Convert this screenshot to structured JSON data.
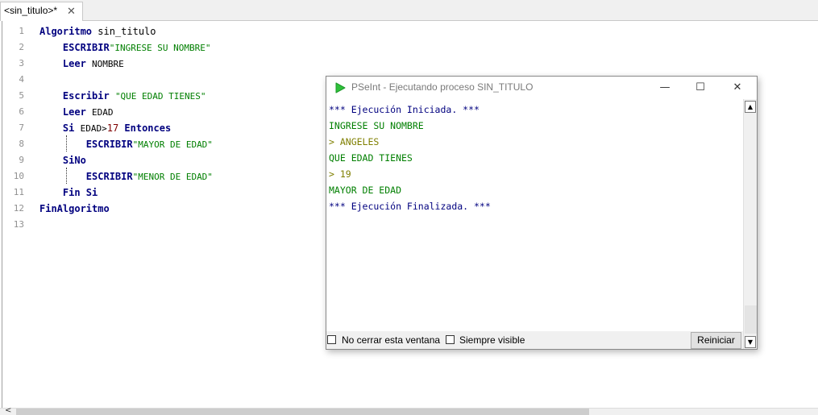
{
  "editor_tab": {
    "title": "<sin_titulo>*",
    "close_symbol": "✕"
  },
  "code_lines": [
    {
      "num": "1",
      "t": [
        {
          "c": "kw",
          "v": "Algoritmo"
        },
        {
          "c": "id",
          "v": " sin_titulo"
        }
      ]
    },
    {
      "num": "2",
      "t": [
        {
          "c": "sp",
          "v": "    "
        },
        {
          "c": "kw",
          "v": "ESCRIBIR"
        },
        {
          "c": "str",
          "v": "\"INGRESE SU NOMBRE\""
        }
      ]
    },
    {
      "num": "3",
      "t": [
        {
          "c": "sp",
          "v": "    "
        },
        {
          "c": "kw",
          "v": "Leer"
        },
        {
          "c": "id",
          "v": " "
        },
        {
          "c": "up",
          "v": "NOMBRE"
        }
      ]
    },
    {
      "num": "4",
      "t": []
    },
    {
      "num": "5",
      "t": [
        {
          "c": "sp",
          "v": "    "
        },
        {
          "c": "kw",
          "v": "Escribir"
        },
        {
          "c": "id",
          "v": " "
        },
        {
          "c": "str",
          "v": "\"QUE EDAD TIENES\""
        }
      ]
    },
    {
      "num": "6",
      "t": [
        {
          "c": "sp",
          "v": "    "
        },
        {
          "c": "kw",
          "v": "Leer"
        },
        {
          "c": "id",
          "v": " "
        },
        {
          "c": "up",
          "v": "EDAD"
        }
      ]
    },
    {
      "num": "7",
      "t": [
        {
          "c": "sp",
          "v": "    "
        },
        {
          "c": "kw",
          "v": "Si"
        },
        {
          "c": "id",
          "v": " "
        },
        {
          "c": "up",
          "v": "EDAD>"
        },
        {
          "c": "num",
          "v": "17"
        },
        {
          "c": "id",
          "v": " "
        },
        {
          "c": "kw",
          "v": "Entonces"
        }
      ]
    },
    {
      "num": "8",
      "t": [
        {
          "c": "sp",
          "v": "        "
        },
        {
          "c": "kw",
          "v": "ESCRIBIR"
        },
        {
          "c": "str",
          "v": "\"MAYOR DE EDAD\""
        }
      ]
    },
    {
      "num": "9",
      "t": [
        {
          "c": "sp",
          "v": "    "
        },
        {
          "c": "kw",
          "v": "SiNo"
        }
      ]
    },
    {
      "num": "10",
      "t": [
        {
          "c": "sp",
          "v": "        "
        },
        {
          "c": "kw",
          "v": "ESCRIBIR"
        },
        {
          "c": "str",
          "v": "\"MENOR DE EDAD\""
        }
      ]
    },
    {
      "num": "11",
      "t": [
        {
          "c": "sp",
          "v": "    "
        },
        {
          "c": "kw",
          "v": "Fin Si"
        }
      ]
    },
    {
      "num": "12",
      "t": [
        {
          "c": "kw",
          "v": "FinAlgoritmo"
        }
      ]
    },
    {
      "num": "13",
      "t": []
    }
  ],
  "execution_window": {
    "title": "PSeInt - Ejecutando proceso SIN_TITULO",
    "minimize_symbol": "—",
    "maximize_symbol": "☐",
    "close_symbol": "✕",
    "console_lines": [
      {
        "text": "*** Ejecución Iniciada. ***",
        "color": "blue"
      },
      {
        "text": "INGRESE SU NOMBRE",
        "color": "green"
      },
      {
        "text": "> ANGELES",
        "color": "olive"
      },
      {
        "text": "QUE EDAD TIENES",
        "color": "green"
      },
      {
        "text": "> 19",
        "color": "olive"
      },
      {
        "text": "MAYOR DE EDAD",
        "color": "green"
      },
      {
        "text": "*** Ejecución Finalizada. ***",
        "color": "blue"
      }
    ],
    "checkbox_no_close": {
      "label": "No cerrar esta ventana",
      "checked": false
    },
    "checkbox_always_visible": {
      "label": "Siempre visible",
      "checked": false
    },
    "restart_button": "Reiniciar",
    "scroll_up_symbol": "▲",
    "scroll_down_symbol": "▼"
  },
  "horizontal_scroll_left_symbol": "<",
  "colors": {
    "keyword": "#00007f",
    "string": "#007f00",
    "number": "#7f0000",
    "console_input": "#7f7f00",
    "pseint_logo": "#2fc13b"
  }
}
